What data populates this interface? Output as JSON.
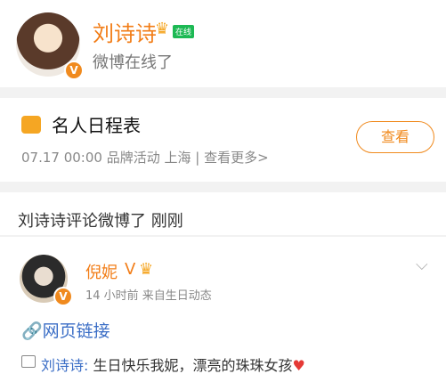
{
  "profile": {
    "name": "刘诗诗",
    "online_badge": "在线",
    "status": "微博在线了",
    "verified_mark": "V"
  },
  "schedule": {
    "title": "名人日程表",
    "description": "07.17 00:00 品牌活动 上海 | 查看更多>",
    "view_button": "查看"
  },
  "activity": {
    "text": "刘诗诗评论微博了 刚刚"
  },
  "post": {
    "author": "倪妮",
    "author_v": "V",
    "meta": "14 小时前  来自生日动态",
    "link_text": "网页链接",
    "comment_author": "刘诗诗:",
    "comment_text": " 生日快乐我妮，漂亮的珠珠女孩",
    "verified_mark": "V"
  },
  "colors": {
    "accent": "#f27d17",
    "link": "#3b6ec6",
    "online": "#1db954"
  }
}
